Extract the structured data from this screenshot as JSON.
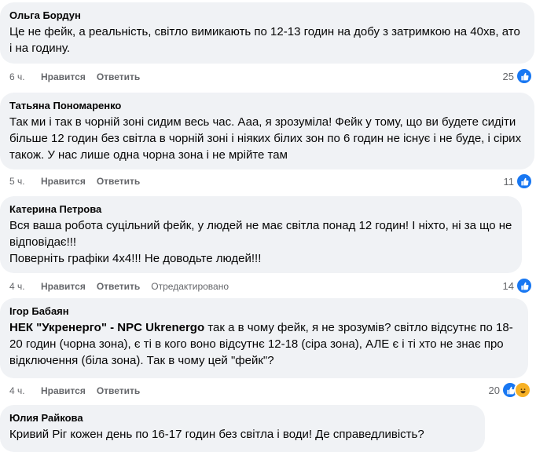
{
  "ui": {
    "like_label": "Нравится",
    "reply_label": "Ответить"
  },
  "comments": [
    {
      "author": "Ольга Бордун",
      "text": "Це не фейк, а реальність, світло вимикають по 12-13 годин на добу з затримкою на 40хв, ато і на годину.",
      "time": "6 ч.",
      "reactions": "25",
      "reaction_icons": [
        "like-icon"
      ]
    },
    {
      "author": "Татьяна Пономаренко",
      "text": "Так ми і так в чорній зоні сидим весь час. Ааа, я зрозуміла! Фейк у тому, що ви будете сидіти більше 12 годин без світла в чорній зоні і ніяких білих зон по 6 годин не існує і не буде, і сірих також. У нас лише одна чорна зона і не мрійте там",
      "time": "5 ч.",
      "reactions": "11",
      "reaction_icons": [
        "like-icon"
      ]
    },
    {
      "author": "Катерина Петрова",
      "text": "Вся ваша робота суцільний фейк, у людей не має світла понад 12 годин! І ніхто, ні за що не відповідає!!!\nПоверніть графіки 4х4!!! Не доводьте людей!!!",
      "time": "4 ч.",
      "edited": "Отредактировано",
      "reactions": "14",
      "reaction_icons": [
        "like-icon"
      ]
    },
    {
      "author": "Ігор Бабаян",
      "mention": "НЕК \"Укренерго\" - NPC Ukrenergo",
      "text": " так а в чому фейк, я не зрозумів? світло відсутнє по 18-20 годин (чорна зона), є ті в кого воно відсутнє 12-18 (сіра зона), АЛЕ є і ті хто не знає про відключення (біла зона). Так в чому цей \"фейк\"?",
      "time": "4 ч.",
      "reactions": "20",
      "reaction_icons": [
        "like-icon",
        "haha-icon"
      ]
    },
    {
      "author": "Юлия Райкова",
      "text": "Кривий Ріг кожен день по 16-17 годин без світла і води! Де справедливість?"
    }
  ]
}
